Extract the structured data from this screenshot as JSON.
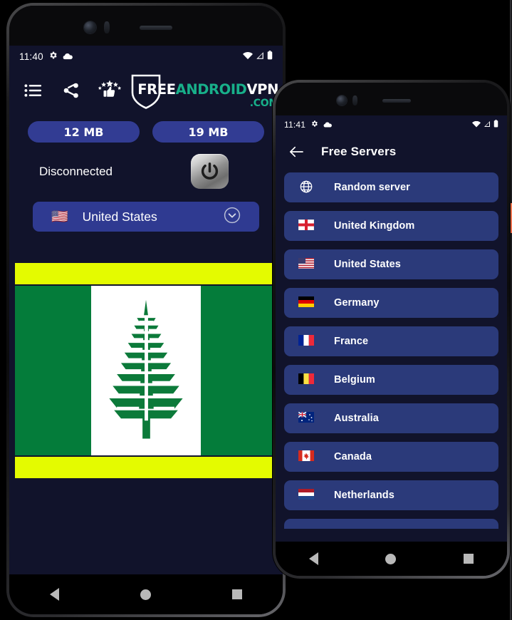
{
  "phone1": {
    "status_bar": {
      "time": "11:40",
      "icons_left": [
        "gear-icon",
        "cloud-icon"
      ],
      "icons_right": [
        "wifi-icon",
        "signal-icon",
        "battery-icon"
      ]
    },
    "toolbar": {
      "icons": [
        {
          "name": "list-icon",
          "label": "Menu"
        },
        {
          "name": "share-icon",
          "label": "Share"
        },
        {
          "name": "rate-icon",
          "label": "Rate us"
        }
      ]
    },
    "logo": {
      "free": "FREE",
      "android": "ANDROID",
      "vpn": "VPN",
      "dotcom": ".COM",
      "accent_color": "#18b08a",
      "text_color": "#ffffff"
    },
    "pills": [
      {
        "name": "download-usage",
        "value": "12 MB"
      },
      {
        "name": "upload-usage",
        "value": "19 MB"
      }
    ],
    "connection": {
      "status_text": "Disconnected",
      "power_button": "power-icon"
    },
    "country_selector": {
      "flag": "🇺🇸",
      "name": "United States",
      "chevron": "chevron-down-icon"
    },
    "banner": {
      "flag_name": "Norfolk Island",
      "band_color": "#047c3a",
      "center_color": "#ffffff",
      "bar_color": "#e4fb00",
      "tree": "norfolk-pine"
    },
    "nav_bar": [
      "back-button",
      "home-button",
      "recents-button"
    ]
  },
  "phone2": {
    "status_bar": {
      "time": "11:41",
      "icons_left": [
        "gear-icon",
        "cloud-icon"
      ],
      "icons_right": [
        "wifi-icon",
        "signal-icon",
        "battery-icon"
      ]
    },
    "app_bar": {
      "back": "back-arrow-icon",
      "title": "Free Servers"
    },
    "servers": [
      {
        "flag": "globe-icon",
        "name": "Random server"
      },
      {
        "flag": "🏴󠁧󠁢󠁥󠁮󠁧󠁿",
        "name": "United Kingdom"
      },
      {
        "flag": "🇺🇸",
        "name": "United States"
      },
      {
        "flag": "🇩🇪",
        "name": "Germany"
      },
      {
        "flag": "🇫🇷",
        "name": "France"
      },
      {
        "flag": "🇧🇪",
        "name": "Belgium"
      },
      {
        "flag": "🇦🇺",
        "name": "Australia"
      },
      {
        "flag": "🇨🇦",
        "name": "Canada"
      },
      {
        "flag": "🇳🇱",
        "name": "Netherlands"
      }
    ],
    "nav_bar": [
      "back-button",
      "home-button",
      "recents-button"
    ]
  },
  "theme": {
    "screen_background": "#11132b",
    "pill_blue": "#323c93",
    "list_blue": "#2b3a7a",
    "selector_blue": "#2f3a91"
  }
}
